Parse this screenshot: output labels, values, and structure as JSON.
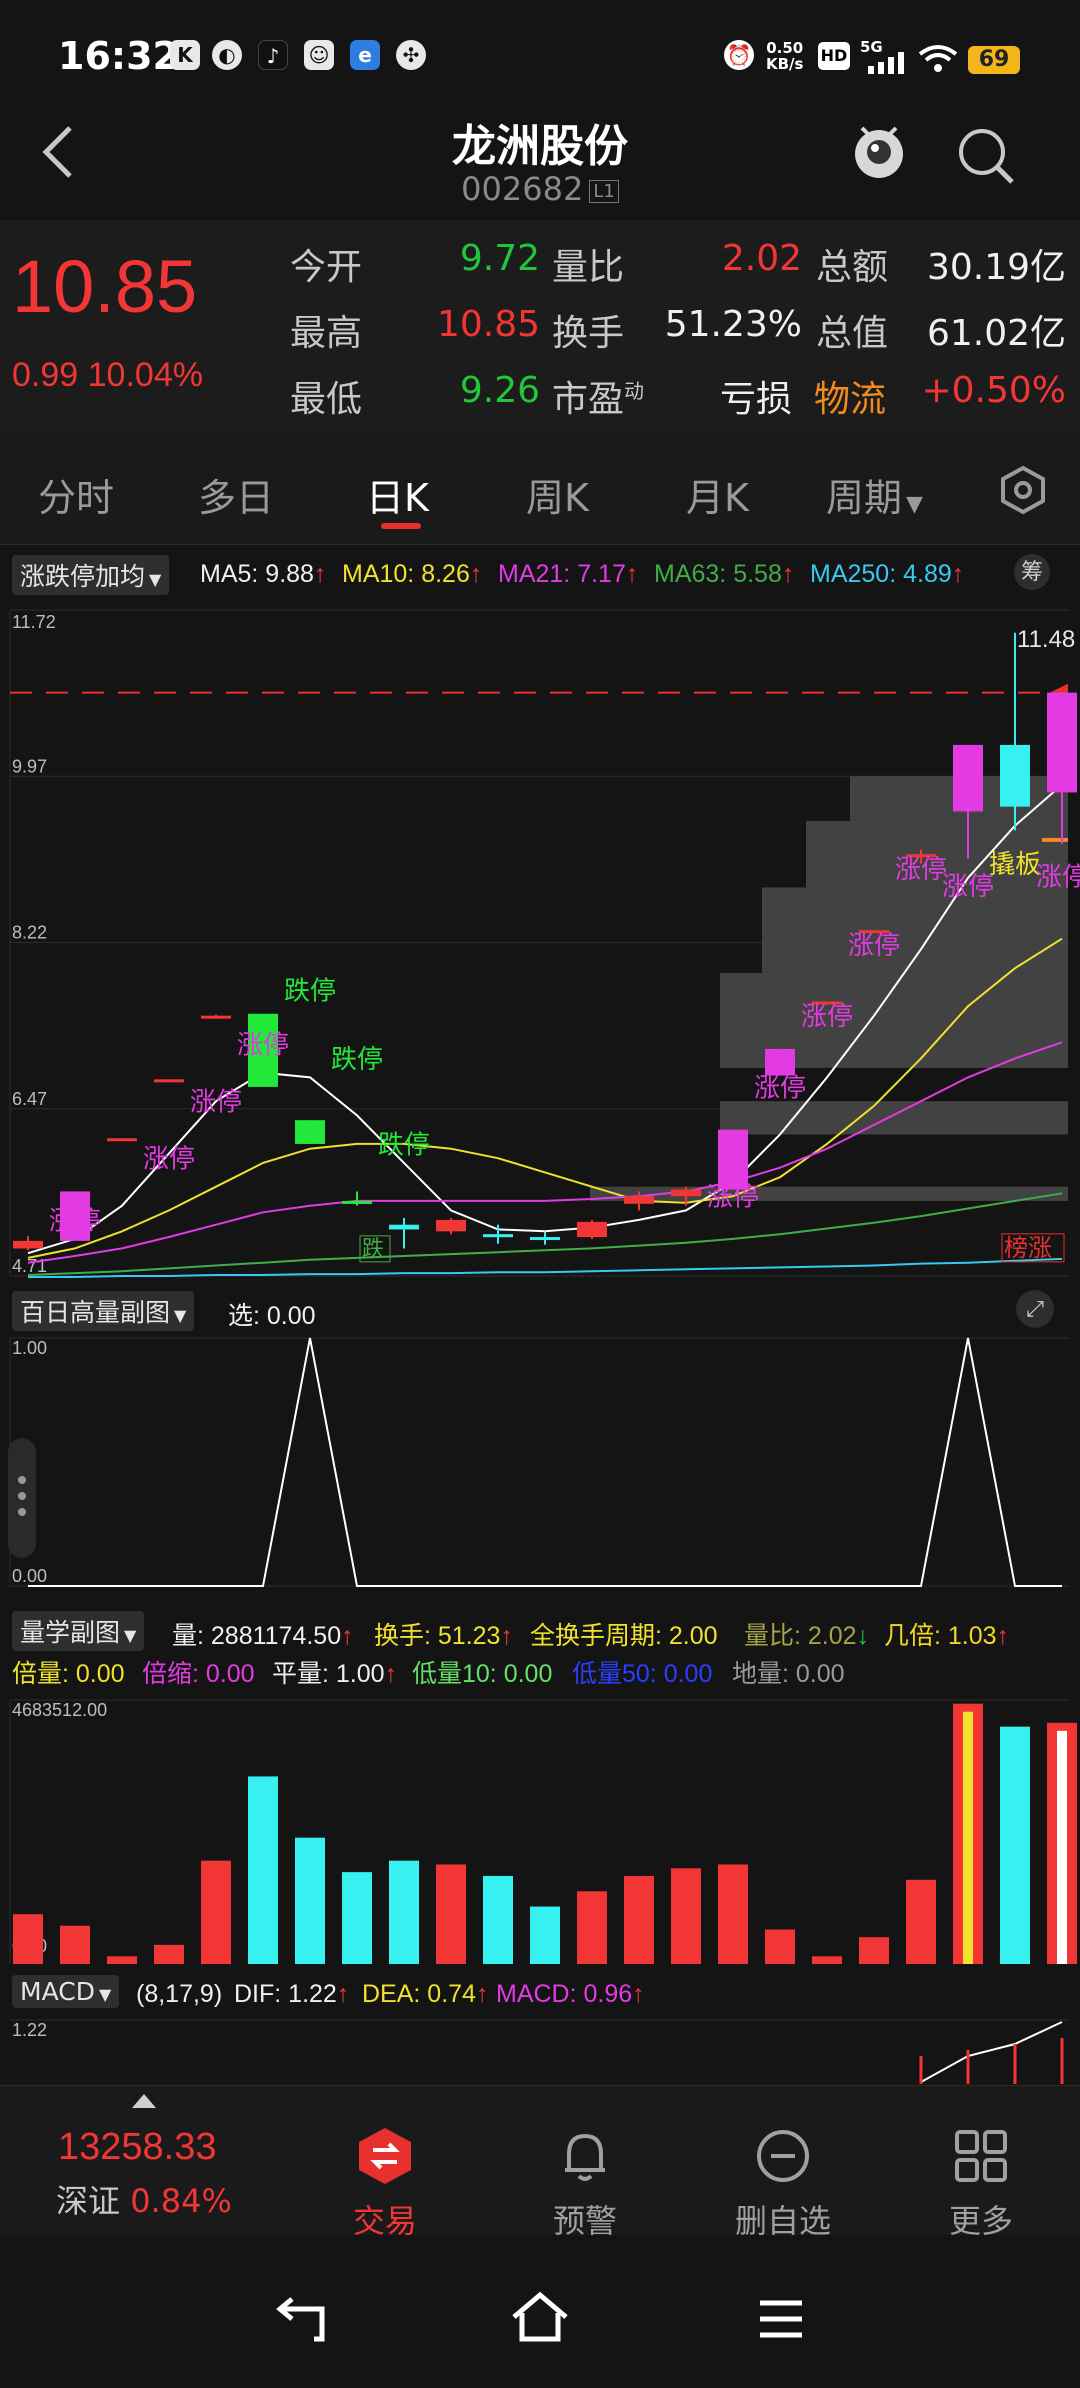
{
  "status": {
    "time": "16:32",
    "net_speed": "0.50",
    "net_unit": "KB/s",
    "hd": "HD",
    "network": "5G",
    "battery": "69"
  },
  "header": {
    "title": "龙洲股份",
    "code": "002682",
    "level": "L1"
  },
  "quote": {
    "price": "10.85",
    "change": "0.99",
    "change_pct": "10.04%",
    "open_label": "今开",
    "open": "9.72",
    "high_label": "最高",
    "high": "10.85",
    "low_label": "最低",
    "low": "9.26",
    "vol_ratio_label": "量比",
    "vol_ratio": "2.02",
    "turnover_label": "换手",
    "turnover": "51.23%",
    "pe_label": "市盈",
    "pe_sup": "动",
    "pe": "亏损",
    "amount_label": "总额",
    "amount": "30.19亿",
    "mktcap_label": "总值",
    "mktcap": "61.02亿",
    "sector": "物流",
    "sector_chg": "+0.50%",
    "colors": {
      "up": "#f23636",
      "down": "#22c63a"
    }
  },
  "tabs": [
    {
      "label": "分时"
    },
    {
      "label": "多日"
    },
    {
      "label": "日K"
    },
    {
      "label": "周K"
    },
    {
      "label": "月K"
    },
    {
      "label": "周期"
    }
  ],
  "main_indicator": {
    "selector": "涨跌停加均",
    "ma5": "MA5: 9.88",
    "ma10": "MA10: 8.26",
    "ma21": "MA21: 7.17",
    "ma63": "MA63: 5.58",
    "ma250": "MA250: 4.89",
    "chip_button": "筹",
    "axis": [
      "11.72",
      "9.97",
      "8.22",
      "6.47",
      "4.71"
    ],
    "high_mark": "11.48",
    "labels": {
      "zt": "涨停",
      "dt": "跌停",
      "qiao": "撬板",
      "die": "跌",
      "bang": "榜涨"
    }
  },
  "sub1": {
    "selector": "百日高量副图",
    "select_text": "选: 0.00",
    "axis": [
      "1.00",
      "0.00"
    ]
  },
  "sub2": {
    "selector": "量学副图",
    "line1": {
      "vol": "量: 2881174.50",
      "turn": "换手: 51.23",
      "period": "全换手周期: 2.00",
      "vr": "量比: 2.02",
      "times": "几倍: 1.03"
    },
    "line2": {
      "bei": "倍量: 0.00",
      "suo": "倍缩: 0.00",
      "ping": "平量: 1.00",
      "di10": "低量10: 0.00",
      "di50": "低量50: 0.00",
      "di": "地量: 0.00"
    },
    "axis": [
      "4683512.00",
      "0.00"
    ]
  },
  "macd": {
    "selector": "MACD",
    "params": "(8,17,9)",
    "dif": "DIF: 1.22",
    "dea": "DEA: 0.74",
    "val": "MACD: 0.96",
    "axis": "1.22"
  },
  "bottom": {
    "index_value": "13258.33",
    "index_name": "深证",
    "index_chg": "0.84%",
    "nav": [
      {
        "label": "交易"
      },
      {
        "label": "预警"
      },
      {
        "label": "删自选"
      },
      {
        "label": "更多"
      }
    ]
  },
  "chart_data": {
    "type": "candlestick",
    "ylim": [
      4.71,
      11.72
    ],
    "candles": [
      {
        "o": 5.0,
        "h": 5.13,
        "l": 4.98,
        "c": 5.08,
        "dir": "up"
      },
      {
        "o": 5.08,
        "h": 5.6,
        "l": 5.08,
        "c": 5.6,
        "dir": "up",
        "limit": true
      },
      {
        "o": 6.16,
        "h": 6.16,
        "l": 6.16,
        "c": 6.16,
        "dir": "up"
      },
      {
        "o": 6.78,
        "h": 6.78,
        "l": 6.78,
        "c": 6.78,
        "dir": "up"
      },
      {
        "o": 7.45,
        "h": 7.46,
        "l": 7.44,
        "c": 7.45,
        "dir": "up"
      },
      {
        "o": 7.47,
        "h": 7.47,
        "l": 6.7,
        "c": 6.7,
        "dir": "down"
      },
      {
        "o": 6.35,
        "h": 6.35,
        "l": 6.1,
        "c": 6.1,
        "dir": "down"
      },
      {
        "o": 5.5,
        "h": 5.6,
        "l": 5.45,
        "c": 5.48,
        "dir": "down"
      },
      {
        "o": 5.25,
        "h": 5.32,
        "l": 5.0,
        "c": 5.2,
        "dir": "flat"
      },
      {
        "o": 5.3,
        "h": 5.32,
        "l": 5.15,
        "c": 5.18,
        "dir": "up"
      },
      {
        "o": 5.15,
        "h": 5.25,
        "l": 5.05,
        "c": 5.12,
        "dir": "flat"
      },
      {
        "o": 5.12,
        "h": 5.18,
        "l": 5.04,
        "c": 5.1,
        "dir": "flat"
      },
      {
        "o": 5.12,
        "h": 5.3,
        "l": 5.1,
        "c": 5.28,
        "dir": "up"
      },
      {
        "o": 5.47,
        "h": 5.6,
        "l": 5.4,
        "c": 5.55,
        "dir": "up"
      },
      {
        "o": 5.55,
        "h": 5.65,
        "l": 5.45,
        "c": 5.62,
        "dir": "up"
      },
      {
        "o": 5.62,
        "h": 6.25,
        "l": 5.62,
        "c": 6.25,
        "dir": "up",
        "limit": true
      },
      {
        "o": 6.82,
        "h": 7.1,
        "l": 6.82,
        "c": 7.1,
        "dir": "up",
        "limit": true
      },
      {
        "o": 7.6,
        "h": 7.6,
        "l": 7.6,
        "c": 7.6,
        "dir": "up"
      },
      {
        "o": 8.35,
        "h": 8.35,
        "l": 8.35,
        "c": 8.35,
        "dir": "up"
      },
      {
        "o": 9.15,
        "h": 9.2,
        "l": 9.05,
        "c": 9.15,
        "dir": "up"
      },
      {
        "o": 9.6,
        "h": 10.3,
        "l": 9.1,
        "c": 10.3,
        "dir": "up",
        "limit": true
      },
      {
        "o": 10.3,
        "h": 11.48,
        "l": 9.4,
        "c": 9.65,
        "dir": "flat"
      },
      {
        "o": 9.8,
        "h": 10.85,
        "l": 9.26,
        "c": 10.85,
        "dir": "up",
        "limit": true
      }
    ],
    "ma_series": [
      {
        "name": "MA5",
        "color": "#ffffff",
        "values": [
          4.95,
          5.1,
          5.45,
          6.0,
          6.55,
          6.85,
          6.8,
          6.4,
          5.9,
          5.4,
          5.2,
          5.18,
          5.22,
          5.3,
          5.4,
          5.7,
          6.2,
          6.8,
          7.45,
          8.15,
          8.9,
          9.45,
          9.88
        ]
      },
      {
        "name": "MA10",
        "color": "#f0e12c",
        "values": [
          4.9,
          5.0,
          5.18,
          5.4,
          5.65,
          5.9,
          6.05,
          6.1,
          6.1,
          6.05,
          5.95,
          5.8,
          5.65,
          5.5,
          5.48,
          5.55,
          5.75,
          6.1,
          6.5,
          7.0,
          7.55,
          7.95,
          8.26
        ]
      },
      {
        "name": "MA21",
        "color": "#e23be3",
        "values": [
          4.85,
          4.92,
          5.0,
          5.12,
          5.25,
          5.38,
          5.45,
          5.5,
          5.5,
          5.5,
          5.5,
          5.5,
          5.52,
          5.55,
          5.6,
          5.7,
          5.85,
          6.05,
          6.3,
          6.55,
          6.8,
          7.0,
          7.17
        ]
      },
      {
        "name": "MA63",
        "color": "#3fae48",
        "values": [
          4.72,
          4.74,
          4.76,
          4.79,
          4.82,
          4.85,
          4.88,
          4.9,
          4.92,
          4.94,
          4.96,
          4.98,
          5.0,
          5.03,
          5.06,
          5.1,
          5.15,
          5.21,
          5.27,
          5.34,
          5.42,
          5.5,
          5.58
        ]
      },
      {
        "name": "MA250",
        "color": "#37c9f0",
        "values": [
          4.7,
          4.7,
          4.71,
          4.71,
          4.72,
          4.72,
          4.73,
          4.73,
          4.74,
          4.74,
          4.75,
          4.75,
          4.76,
          4.77,
          4.78,
          4.79,
          4.8,
          4.81,
          4.82,
          4.84,
          4.85,
          4.87,
          4.89
        ]
      }
    ],
    "high_volume_flag": [
      0,
      0,
      0,
      0,
      0,
      0,
      1,
      0,
      0,
      0,
      0,
      0,
      0,
      0,
      0,
      0,
      0,
      0,
      0,
      0,
      1,
      0,
      0
    ],
    "volumes": [
      {
        "v": 0.13,
        "c": "#f23636"
      },
      {
        "v": 0.1,
        "c": "#f23636"
      },
      {
        "v": 0.02,
        "c": "#f23636"
      },
      {
        "v": 0.05,
        "c": "#f23636"
      },
      {
        "v": 0.27,
        "c": "#f23636"
      },
      {
        "v": 0.49,
        "c": "#37f0f0"
      },
      {
        "v": 0.33,
        "c": "#37f0f0"
      },
      {
        "v": 0.24,
        "c": "#37f0f0"
      },
      {
        "v": 0.27,
        "c": "#37f0f0"
      },
      {
        "v": 0.26,
        "c": "#f23636"
      },
      {
        "v": 0.23,
        "c": "#37f0f0"
      },
      {
        "v": 0.15,
        "c": "#37f0f0"
      },
      {
        "v": 0.19,
        "c": "#f23636"
      },
      {
        "v": 0.23,
        "c": "#f23636"
      },
      {
        "v": 0.25,
        "c": "#f23636"
      },
      {
        "v": 0.26,
        "c": "#f23636"
      },
      {
        "v": 0.09,
        "c": "#f23636"
      },
      {
        "v": 0.02,
        "c": "#f23636"
      },
      {
        "v": 0.07,
        "c": "#f23636"
      },
      {
        "v": 0.22,
        "c": "#f23636"
      },
      {
        "v": 0.68,
        "c": "#f23636"
      },
      {
        "v": 0.62,
        "c": "#37f0f0"
      },
      {
        "v": 0.63,
        "c": "#f23636"
      }
    ]
  }
}
